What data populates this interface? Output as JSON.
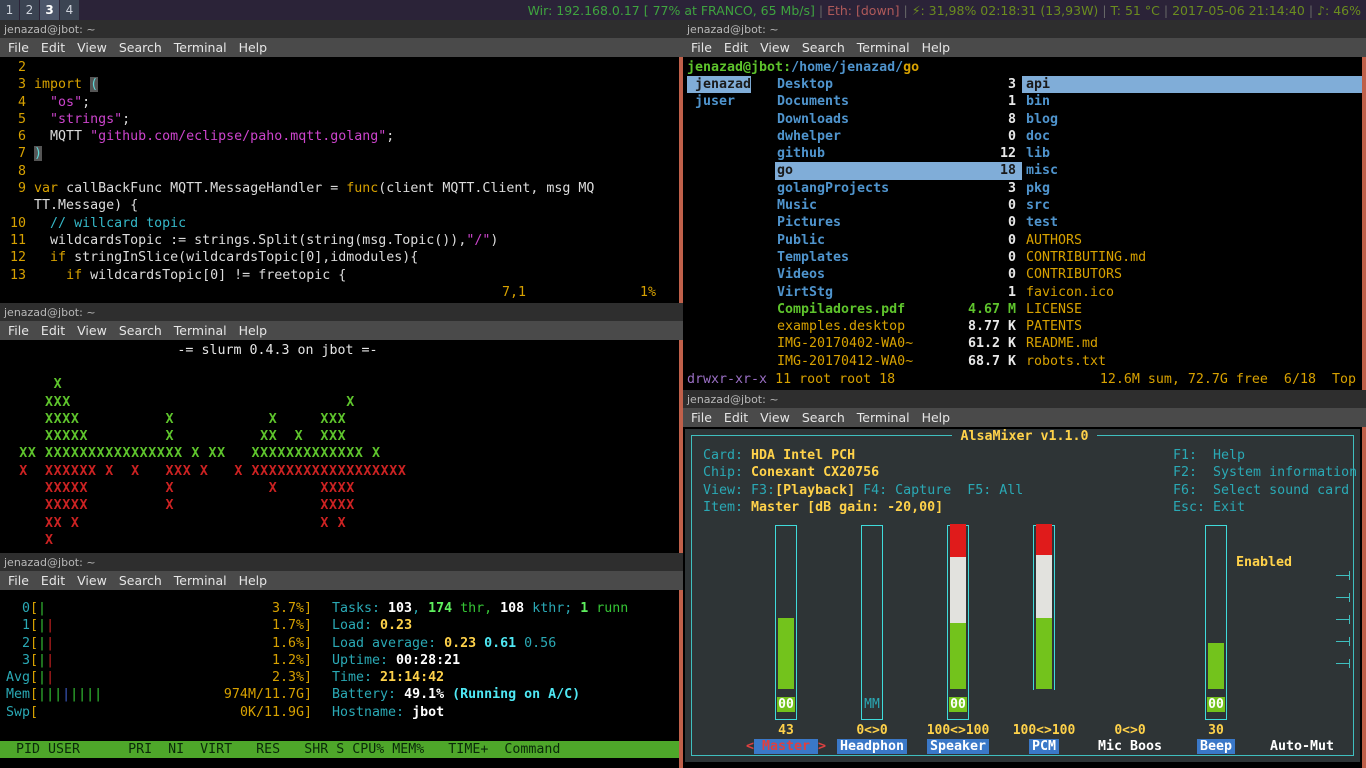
{
  "statusbar": {
    "workspaces": [
      {
        "label": "1",
        "focused": false
      },
      {
        "label": "2",
        "focused": false
      },
      {
        "label": "3",
        "focused": true
      },
      {
        "label": "4",
        "focused": false
      }
    ],
    "wifi": "Wir: 192.168.0.17 [ 77% at FRANCO, 65 Mb/s]",
    "eth_label": "Eth: ",
    "eth_value": "[down]",
    "battery_icon": "⚡",
    "battery": ": 31,98% 02:18:31 (13,93W)",
    "temp": "T: 51 °C",
    "datetime": "2017-05-06 21:14:40",
    "volume_icon": "♪",
    "volume": ": 46%",
    "separator": "|",
    "colors": {
      "green": "#3fa33f",
      "red": "#b05a5a",
      "bg": "#2b2338"
    }
  },
  "menu": {
    "items": [
      "File",
      "Edit",
      "View",
      "Search",
      "Terminal",
      "Help"
    ]
  },
  "vim_window": {
    "title": "jenazad@jbot: ~",
    "lines": [
      {
        "num": "  2",
        "segs": []
      },
      {
        "num": "  3",
        "segs": [
          {
            "t": "import ",
            "c": "c-kw"
          },
          {
            "t": "(",
            "c": "c-paren"
          }
        ]
      },
      {
        "num": "  4",
        "segs": [
          {
            "t": "  ",
            "c": "c-plain"
          },
          {
            "t": "\"os\"",
            "c": "c-str"
          },
          {
            "t": ";",
            "c": "c-plain"
          }
        ]
      },
      {
        "num": "  5",
        "segs": [
          {
            "t": "  ",
            "c": "c-plain"
          },
          {
            "t": "\"strings\"",
            "c": "c-str"
          },
          {
            "t": ";",
            "c": "c-plain"
          }
        ]
      },
      {
        "num": "  6",
        "segs": [
          {
            "t": "  MQTT ",
            "c": "c-plain"
          },
          {
            "t": "\"github.com/eclipse/paho.mqtt.golang\"",
            "c": "c-str"
          },
          {
            "t": ";",
            "c": "c-plain"
          }
        ]
      },
      {
        "num": "  7",
        "segs": [
          {
            "t": ")",
            "c": "c-paren"
          }
        ]
      },
      {
        "num": "  8",
        "segs": []
      },
      {
        "num": "  9",
        "segs": [
          {
            "t": "var",
            "c": "c-kw"
          },
          {
            "t": " callBackFunc MQTT.MessageHandler = ",
            "c": "c-plain"
          },
          {
            "t": "func",
            "c": "c-kw"
          },
          {
            "t": "(client MQTT.Client, msg MQ",
            "c": "c-plain"
          }
        ]
      },
      {
        "num": "   ",
        "segs": [
          {
            "t": "TT.Message) {",
            "c": "c-plain"
          }
        ]
      },
      {
        "num": " 10",
        "segs": [
          {
            "t": "  ",
            "c": "c-plain"
          },
          {
            "t": "// willcard topic",
            "c": "c-comment"
          }
        ]
      },
      {
        "num": " 11",
        "segs": [
          {
            "t": "  wildcardsTopic := strings.Split(string(msg.Topic()),",
            "c": "c-plain"
          },
          {
            "t": "\"/\"",
            "c": "c-str"
          },
          {
            "t": ")",
            "c": "c-plain"
          }
        ]
      },
      {
        "num": " 12",
        "segs": [
          {
            "t": "  ",
            "c": "c-plain"
          },
          {
            "t": "if",
            "c": "c-kw"
          },
          {
            "t": " stringInSlice(wildcardsTopic[0],idmodules){",
            "c": "c-plain"
          }
        ]
      },
      {
        "num": " 13",
        "segs": [
          {
            "t": "    ",
            "c": "c-plain"
          },
          {
            "t": "if",
            "c": "c-kw"
          },
          {
            "t": " wildcardsTopic[0] != freetopic {",
            "c": "c-plain"
          }
        ]
      }
    ],
    "status_pos": "7,1",
    "status_pct": "1%"
  },
  "slurm_window": {
    "title": "jenazad@jbot: ~",
    "header": "-= slurm 0.4.3 on jbot =-",
    "graph_rows": [
      {
        "color": "green",
        "text": "      x"
      },
      {
        "color": "green",
        "text": "     xxx                                x"
      },
      {
        "color": "green",
        "text": "     xxxx          x           x     xxx"
      },
      {
        "color": "green",
        "text": "     xxxxx         x          xx  x  xxx"
      },
      {
        "color": "green",
        "text": "  xx xxxxxxxxxxxxxxxx x xx   xxxxxxxxxxxxx x"
      },
      {
        "color": "red",
        "text": "  x  xxxxxx x  x   xxx x   x xxxxxxxxxxxxxxxxxx"
      },
      {
        "color": "red",
        "text": "     xxxxx         x           x     xxxx"
      },
      {
        "color": "red",
        "text": "     xxxxx         x                 xxxx"
      },
      {
        "color": "red",
        "text": "     xx x                            x x"
      },
      {
        "color": "red",
        "text": "     x"
      }
    ]
  },
  "htop_window": {
    "title": "jenazad@jbot: ~",
    "cpu_rows": [
      {
        "label": "  0",
        "bars": [
          {
            "ch": "|",
            "c": "h-green"
          }
        ],
        "value": "3.7%"
      },
      {
        "label": "  1",
        "bars": [
          {
            "ch": "|",
            "c": "h-green"
          },
          {
            "ch": "|",
            "c": "h-red"
          }
        ],
        "value": "1.7%"
      },
      {
        "label": "  2",
        "bars": [
          {
            "ch": "|",
            "c": "h-green"
          },
          {
            "ch": "|",
            "c": "h-red"
          }
        ],
        "value": "1.6%"
      },
      {
        "label": "  3",
        "bars": [
          {
            "ch": "|",
            "c": "h-green"
          },
          {
            "ch": "|",
            "c": "h-red"
          }
        ],
        "value": "1.2%"
      },
      {
        "label": "Avg",
        "bars": [
          {
            "ch": "|",
            "c": "h-green"
          },
          {
            "ch": "|",
            "c": "h-red"
          }
        ],
        "value": "2.3%"
      }
    ],
    "mem_label": "Mem",
    "mem_bars": [
      {
        "ch": "|",
        "c": "h-green"
      },
      {
        "ch": "|",
        "c": "h-green"
      },
      {
        "ch": "|",
        "c": "h-green"
      },
      {
        "ch": "|",
        "c": "h-blue"
      },
      {
        "ch": "|",
        "c": "h-green"
      },
      {
        "ch": "|",
        "c": "h-green"
      },
      {
        "ch": "|",
        "c": "h-green"
      },
      {
        "ch": "|",
        "c": "h-green"
      }
    ],
    "mem_value": "974M/11.7G",
    "swp_label": "Swp",
    "swp_value": "0K/11.9G",
    "stats": {
      "tasks_label": "Tasks: ",
      "tasks_n": "103",
      "tasks_mid": ", ",
      "thr_n": "174",
      "thr_label": " thr, ",
      "kthr_n": "108",
      "kthr_label": " kthr; ",
      "runn_n": "1",
      "runn_label": " runn",
      "load_label": "Load: ",
      "load_value": "0.23",
      "loadavg_label": "Load average: ",
      "loadavg_1": "0.23",
      "loadavg_5": "0.61",
      "loadavg_15": "0.56",
      "uptime_label": "Uptime: ",
      "uptime_value": "00:28:21",
      "time_label": "Time: ",
      "time_value": "21:14:42",
      "battery_label": "Battery: ",
      "battery_value": "49.1%",
      "battery_note": " (Running on A/C)",
      "hostname_label": "Hostname: ",
      "hostname_value": "jbot"
    },
    "table_header": "  PID USER      PRI  NI  VIRT   RES   SHR S CPU% MEM%   TIME+  Command"
  },
  "ranger_window": {
    "title": "jenazad@jbot: ~",
    "path_user": "jenazad@jbot",
    "path_sep": ":",
    "path_base": "/home/jenazad/",
    "path_dir": "go",
    "col_parents": [
      {
        "name": "jenazad",
        "selected": true
      },
      {
        "name": "juser",
        "selected": false
      }
    ],
    "col_current": [
      {
        "name": "Desktop",
        "size": "3",
        "type": "dir",
        "selected": false
      },
      {
        "name": "Documents",
        "size": "1",
        "type": "dir",
        "selected": false
      },
      {
        "name": "Downloads",
        "size": "8",
        "type": "dir",
        "selected": false
      },
      {
        "name": "dwhelper",
        "size": "0",
        "type": "dir",
        "selected": false
      },
      {
        "name": "github",
        "size": "12",
        "type": "dir",
        "selected": false
      },
      {
        "name": "go",
        "size": "18",
        "type": "dir",
        "selected": true
      },
      {
        "name": "golangProjects",
        "size": "3",
        "type": "dir",
        "selected": false
      },
      {
        "name": "Music",
        "size": "0",
        "type": "dir",
        "selected": false
      },
      {
        "name": "Pictures",
        "size": "0",
        "type": "dir",
        "selected": false
      },
      {
        "name": "Public",
        "size": "0",
        "type": "dir",
        "selected": false
      },
      {
        "name": "Templates",
        "size": "0",
        "type": "dir",
        "selected": false
      },
      {
        "name": "Videos",
        "size": "0",
        "type": "dir",
        "selected": false
      },
      {
        "name": "VirtStg",
        "size": "1",
        "type": "dir",
        "selected": false
      },
      {
        "name": "Compiladores.pdf",
        "size": "4.67 M",
        "type": "exec",
        "selected": false
      },
      {
        "name": "examples.desktop",
        "size": "8.77 K",
        "type": "file",
        "selected": false
      },
      {
        "name": "IMG-20170402-WA0~",
        "size": "61.2 K",
        "type": "file",
        "selected": false
      },
      {
        "name": "IMG-20170412-WA0~",
        "size": "68.7 K",
        "type": "file",
        "selected": false
      }
    ],
    "col_preview": [
      {
        "name": "api",
        "type": "dir",
        "selected": true
      },
      {
        "name": "bin",
        "type": "dir",
        "selected": false
      },
      {
        "name": "blog",
        "type": "dir",
        "selected": false
      },
      {
        "name": "doc",
        "type": "dir",
        "selected": false
      },
      {
        "name": "lib",
        "type": "dir",
        "selected": false
      },
      {
        "name": "misc",
        "type": "dir",
        "selected": false
      },
      {
        "name": "pkg",
        "type": "dir",
        "selected": false
      },
      {
        "name": "src",
        "type": "dir",
        "selected": false
      },
      {
        "name": "test",
        "type": "dir",
        "selected": false
      },
      {
        "name": "AUTHORS",
        "type": "file",
        "selected": false
      },
      {
        "name": "CONTRIBUTING.md",
        "type": "file",
        "selected": false
      },
      {
        "name": "CONTRIBUTORS",
        "type": "file",
        "selected": false
      },
      {
        "name": "favicon.ico",
        "type": "file",
        "selected": false
      },
      {
        "name": "LICENSE",
        "type": "file",
        "selected": false
      },
      {
        "name": "PATENTS",
        "type": "file",
        "selected": false
      },
      {
        "name": "README.md",
        "type": "file",
        "selected": false
      },
      {
        "name": "robots.txt",
        "type": "file",
        "selected": false
      }
    ],
    "status_perm": "drwxr-xr-x",
    "status_meta": "11 root root 18",
    "status_right": "12.6M sum, 72.7G free  6/18  Top"
  },
  "alsamixer_window": {
    "title": "jenazad@jbot: ~",
    "app_title": "AlsaMixer v1.1.0",
    "info": {
      "card_label": "Card:",
      "card_value": "HDA Intel PCH",
      "chip_label": "Chip:",
      "chip_value": "Conexant CX20756",
      "view_label": "View:",
      "view_f3": "F3:",
      "view_playback": "[Playback]",
      "view_f4": "F4: Capture",
      "view_f5": "F5: All",
      "item_label": "Item:",
      "item_value": "Master [dB gain: -20,00]"
    },
    "help": [
      {
        "key": "F1:",
        "desc": "Help"
      },
      {
        "key": "F2:",
        "desc": "System information"
      },
      {
        "key": "F6:",
        "desc": "Select sound card"
      },
      {
        "key": "Esc:",
        "desc": "Exit"
      }
    ],
    "channels": [
      {
        "name": "Master",
        "label": "Master",
        "value": "43",
        "mute": "00",
        "green_pct": 43,
        "white_pct": 0,
        "red_pct": 0,
        "has_box": true,
        "selected": true,
        "highlight": true
      },
      {
        "name": "Headphone",
        "label": "Headphon",
        "value": "0<>0",
        "mute": "MM",
        "green_pct": 0,
        "white_pct": 0,
        "red_pct": 0,
        "has_box": true,
        "selected": false,
        "highlight": true
      },
      {
        "name": "Speaker",
        "label": "Speaker",
        "value": "100<>100",
        "mute": "00",
        "green_pct": 40,
        "white_pct": 40,
        "red_pct": 20,
        "has_box": true,
        "selected": false,
        "highlight": true
      },
      {
        "name": "PCM",
        "label": "PCM",
        "value": "100<>100",
        "mute": "",
        "green_pct": 43,
        "white_pct": 38,
        "red_pct": 19,
        "has_box": false,
        "selected": false,
        "highlight": true
      },
      {
        "name": "Mic Boost",
        "label": "Mic Boos",
        "value": "0<>0",
        "mute": "",
        "green_pct": 0,
        "white_pct": 0,
        "red_pct": 0,
        "has_box": false,
        "selected": false,
        "highlight": false
      },
      {
        "name": "Beep",
        "label": "Beep",
        "value": "30",
        "mute": "00",
        "green_pct": 28,
        "white_pct": 0,
        "red_pct": 0,
        "has_box": true,
        "selected": false,
        "highlight": true
      },
      {
        "name": "Auto-Mute",
        "label": "Auto-Mut",
        "value": "",
        "mute": "",
        "green_pct": 0,
        "white_pct": 0,
        "red_pct": 0,
        "has_box": false,
        "selected": false,
        "highlight": false,
        "enabled_text": "Enabled"
      }
    ],
    "arrow_left": "<",
    "arrow_right": ">"
  }
}
